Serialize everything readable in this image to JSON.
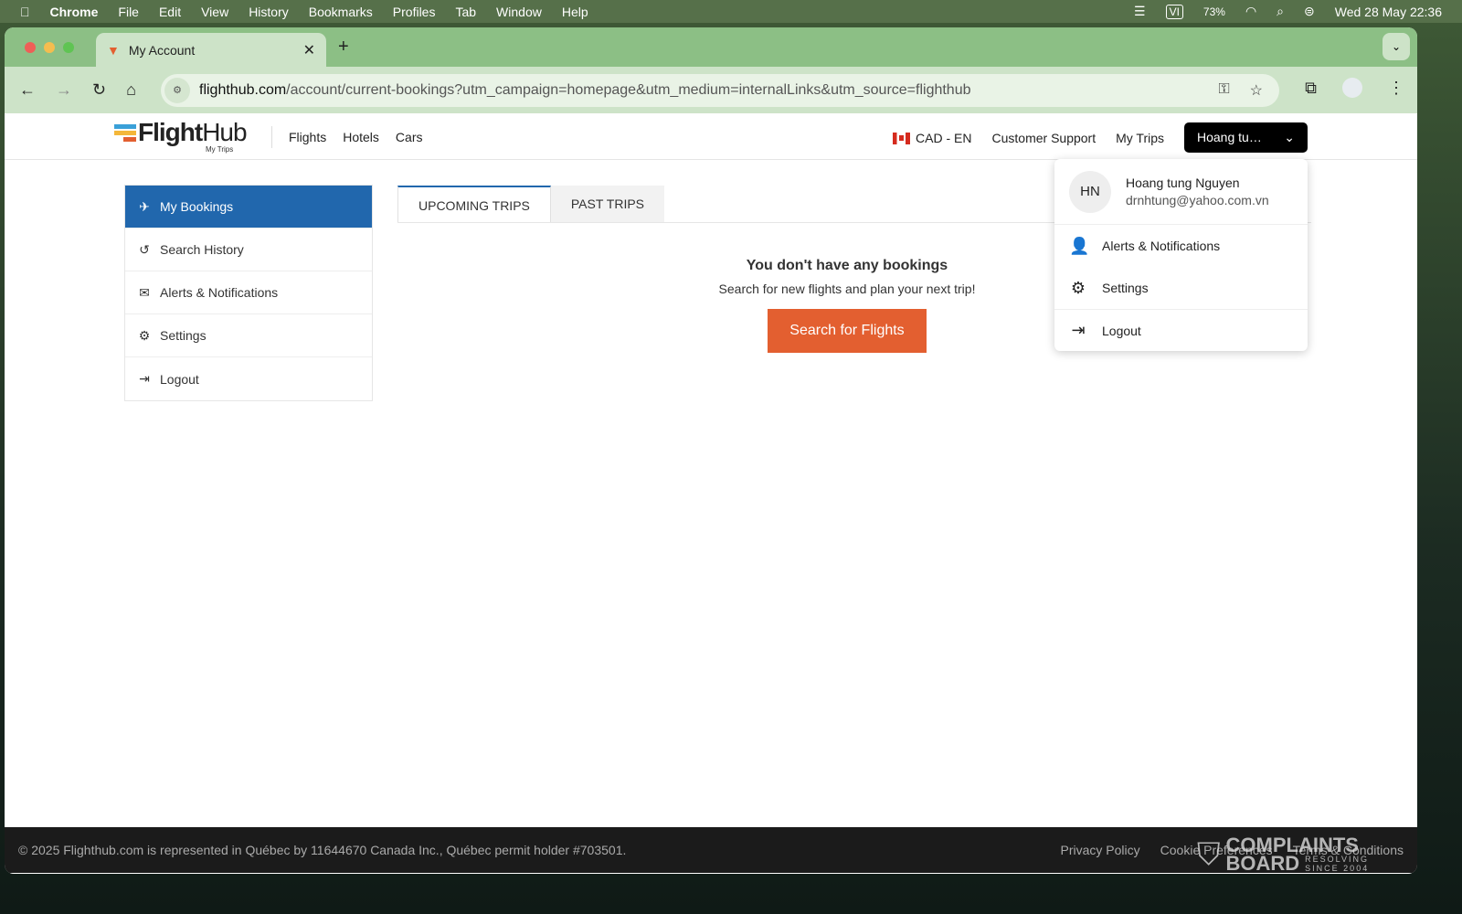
{
  "menubar": {
    "app": "Chrome",
    "items": [
      "File",
      "Edit",
      "View",
      "History",
      "Bookmarks",
      "Profiles",
      "Tab",
      "Window",
      "Help"
    ],
    "input": "VI",
    "battery": "73%",
    "datetime": "Wed 28 May  22:36"
  },
  "browser": {
    "tab_title": "My Account",
    "url_domain": "flighthub.com",
    "url_path": "/account/current-bookings?utm_campaign=homepage&utm_medium=internalLinks&utm_source=flighthub"
  },
  "header": {
    "logo_bold": "Flight",
    "logo_light": "Hub",
    "logo_sub": "My Trips",
    "nav": [
      "Flights",
      "Hotels",
      "Cars"
    ],
    "locale": "CAD - EN",
    "support": "Customer Support",
    "my_trips": "My Trips",
    "user_short": "Hoang tu…"
  },
  "sidebar": {
    "items": [
      {
        "label": "My Bookings",
        "icon": "plane-icon"
      },
      {
        "label": "Search History",
        "icon": "history-icon"
      },
      {
        "label": "Alerts & Notifications",
        "icon": "envelope-icon"
      },
      {
        "label": "Settings",
        "icon": "gear-icon"
      },
      {
        "label": "Logout",
        "icon": "logout-icon"
      }
    ]
  },
  "tabs": {
    "upcoming": "UPCOMING TRIPS",
    "past": "PAST TRIPS"
  },
  "empty": {
    "title": "You don't have any bookings",
    "subtitle": "Search for new flights and plan your next trip!",
    "button": "Search for Flights"
  },
  "dropdown": {
    "initials": "HN",
    "name": "Hoang tung Nguyen",
    "email": "drnhtung@yahoo.com.vn",
    "items": [
      "Alerts & Notifications",
      "Settings",
      "Logout"
    ]
  },
  "footer": {
    "copyright": "© 2025 Flighthub.com is represented in Québec by 11644670 Canada Inc., Québec permit holder #703501.",
    "links": [
      "Privacy Policy",
      "Cookie Preferences",
      "Terms & Conditions"
    ]
  },
  "watermark": {
    "line1": "COMPLAINTS",
    "line2": "BOARD",
    "tag1": "RESOLVING",
    "tag2": "SINCE 2004"
  },
  "colors": {
    "primary": "#2167ad",
    "cta": "#e35f30"
  }
}
